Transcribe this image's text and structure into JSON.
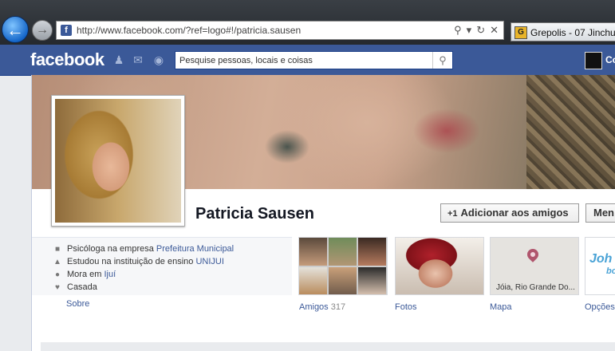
{
  "browser": {
    "url": "http://www.facebook.com/?ref=logo#!/patricia.sausen",
    "tab_title": "Grepolis - 07 Jinchu",
    "tab_favicon": "G"
  },
  "topbar": {
    "logo": "facebook",
    "search_placeholder": "Pesquise pessoas, locais e coisas",
    "user_initial": "Co"
  },
  "profile": {
    "name": "Patricia Sausen",
    "add_friend_label": "Adicionar aos amigos",
    "message_label": "Men"
  },
  "info": {
    "work_prefix": "Psicóloga na empresa",
    "work_link": "Prefeitura Municipal",
    "study_prefix": "Estudou na instituição de ensino",
    "study_link": "UNIJUI",
    "live_prefix": "Mora em",
    "live_link": "Ijuí",
    "relationship": "Casada",
    "about": "Sobre"
  },
  "tiles": {
    "friends_label": "Amigos",
    "friends_count": "317",
    "photos_label": "Fotos",
    "map_label": "Mapa",
    "map_place": "Jóia, Rio Grande Do...",
    "options_label": "Opções",
    "options_partial_text": "Joh",
    "options_partial_text2": "bo"
  },
  "colors": {
    "brand": "#3b5998",
    "link": "#3b5998"
  }
}
